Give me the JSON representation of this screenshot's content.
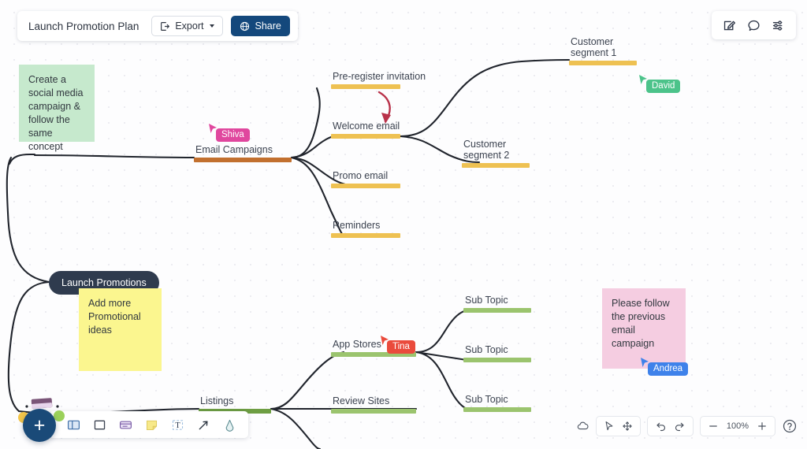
{
  "header": {
    "doc_title": "Launch Promotion Plan",
    "export_label": "Export",
    "share_label": "Share",
    "icons": {
      "export": "export-icon",
      "share": "globe-icon",
      "caret": "chevron-down-icon"
    }
  },
  "top_right_tools": [
    {
      "name": "edit-icon",
      "title": "Edit"
    },
    {
      "name": "comment-icon",
      "title": "Comment"
    },
    {
      "name": "settings-sliders-icon",
      "title": "Settings"
    }
  ],
  "mindmap": {
    "root": {
      "label": "Launch Promotions",
      "color": "#2f3b4e"
    },
    "branches": [
      {
        "id": "email-campaigns",
        "label": "Email Campaigns",
        "color": "#c2702f",
        "children": [
          {
            "id": "pre-register-invitation",
            "label": "Pre-register invitation",
            "color": "#eec152"
          },
          {
            "id": "welcome-email",
            "label": "Welcome email",
            "color": "#eec152",
            "children": [
              {
                "id": "customer-segment-1",
                "label": "Customer\nsegment 1",
                "color": "#eec152"
              },
              {
                "id": "customer-segment-2",
                "label": "Customer\nsegment 2",
                "color": "#eec152"
              }
            ]
          },
          {
            "id": "promo-email",
            "label": "Promo email",
            "color": "#eec152"
          },
          {
            "id": "reminders",
            "label": "Reminders",
            "color": "#eec152"
          }
        ]
      },
      {
        "id": "listings",
        "label": "Listings",
        "color": "#6e9e43",
        "children": [
          {
            "id": "app-stores",
            "label": "App Stores",
            "color": "#9bc46e",
            "children": [
              {
                "id": "sub-topic-1",
                "label": "Sub Topic",
                "color": "#9bc46e"
              },
              {
                "id": "sub-topic-2",
                "label": "Sub Topic",
                "color": "#9bc46e"
              },
              {
                "id": "sub-topic-3",
                "label": "Sub Topic",
                "color": "#9bc46e"
              }
            ]
          },
          {
            "id": "review-sites",
            "label": "Review Sites",
            "color": "#9bc46e"
          }
        ]
      }
    ],
    "annotation_arrow": {
      "name": "red-curved-arrow",
      "color": "#b9324a",
      "from": "pre-register-invitation",
      "to": "welcome-email"
    }
  },
  "sticky_notes": [
    {
      "id": "green",
      "text": "Create a social media campaign & follow the same concept",
      "color": "#c6e9cd"
    },
    {
      "id": "yellow",
      "text": "Add more Promotional ideas",
      "color": "#fbf68f"
    },
    {
      "id": "pink",
      "text": "Please follow the previous email campaign",
      "color": "#f5cde1"
    }
  ],
  "collaborators": [
    {
      "name": "Shiva",
      "color": "#e0479e"
    },
    {
      "name": "David",
      "color": "#4cc38a"
    },
    {
      "name": "Tina",
      "color": "#ea4b3c"
    },
    {
      "name": "Andrea",
      "color": "#3f82ea"
    }
  ],
  "bottom_toolbar": [
    {
      "name": "frame-icon",
      "title": "Frame"
    },
    {
      "name": "shape-square-icon",
      "title": "Shape"
    },
    {
      "name": "card-icon",
      "title": "Card"
    },
    {
      "name": "sticky-note-icon",
      "title": "Sticky note"
    },
    {
      "name": "text-tool-icon",
      "title": "Text"
    },
    {
      "name": "arrow-tool-icon",
      "title": "Arrow"
    },
    {
      "name": "pen-tool-icon",
      "title": "Pen"
    }
  ],
  "fab": {
    "label": "+",
    "name": "add-button"
  },
  "bottom_right": {
    "cloud_icon": "cloud-save-icon",
    "select_icon": "cursor-select-icon",
    "pan_icon": "pan-move-icon",
    "undo_icon": "undo-icon",
    "redo_icon": "redo-icon",
    "zoom_out_icon": "zoom-out-icon",
    "zoom_in_icon": "zoom-in-icon",
    "zoom_level": "100%",
    "help_icon": "help-icon"
  }
}
